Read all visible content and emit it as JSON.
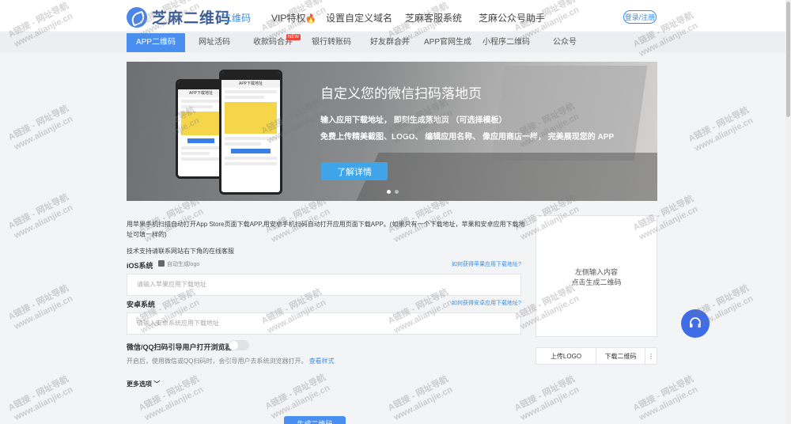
{
  "header": {
    "logo_text": "芝麻二维码",
    "nav": [
      {
        "label": "二维码"
      },
      {
        "label": "VIP特权"
      },
      {
        "label": "设置自定义域名"
      },
      {
        "label": "芝麻客服系统"
      },
      {
        "label": "芝麻公众号助手"
      }
    ],
    "login_label": "登录/注册"
  },
  "subnav": {
    "items": [
      {
        "label": "APP二维码"
      },
      {
        "label": "网址活码"
      },
      {
        "label": "收款码合并"
      },
      {
        "label": "银行转账码"
      },
      {
        "label": "好友群合并"
      },
      {
        "label": "APP官网生成"
      },
      {
        "label": "小程序二维码"
      },
      {
        "label": "公众号"
      }
    ],
    "hot_tag": "NEW"
  },
  "banner": {
    "title": "自定义您的微信扫码落地页",
    "line1": "输入应用下载地址， 即刻生成落地页 （可选择模板）",
    "line2": "免费上传精美截图、LOGO、 编辑应用名称、 像应用商店一样， 完美展现您的 APP",
    "button": "了解详情",
    "phone_left_title": "APP下载地址",
    "phone_right_title": "APP下载地址"
  },
  "form": {
    "desc": "用苹果手机扫描自动打开App Store页面下载APP,用安卓手机扫码自动打开应用页面下载APP。(如果只有一个下载地址，苹果和安卓应用下载地址可填一样的)",
    "support_note": "技术支持请联系网站右下角的在线客服",
    "ios_label": "iOS系统",
    "auto_logo": "自动生成logo",
    "ios_help": "如何获得苹果应用下载地址?",
    "ios_placeholder": "请输入苹果应用下载地址",
    "android_label": "安卓系统",
    "android_help": "如何获得安卓应用下载地址?",
    "android_placeholder": "请输入安卓系统应用下载地址",
    "browser_toggle": "微信/QQ扫码引导用户打开浏览器",
    "browser_hint": "开启后，使用微信或QQ扫码时，会引导用户去系统浏览器打开。",
    "view_style": "查看样式",
    "more_options": "更多选项",
    "submit": "生成二维码"
  },
  "preview": {
    "line1": "左侧输入内容",
    "line2": "点击生成二维码",
    "upload_logo": "上传LOGO",
    "download_qr": "下载二维码",
    "more": "⋮"
  },
  "watermark": {
    "line1": "A链接 - 网址导航",
    "line2": "www.alianjie.cn"
  },
  "colors": {
    "accent": "#3a8ee6",
    "subnav_active": "#4a8ef0",
    "support_button": "#3f6de8"
  }
}
